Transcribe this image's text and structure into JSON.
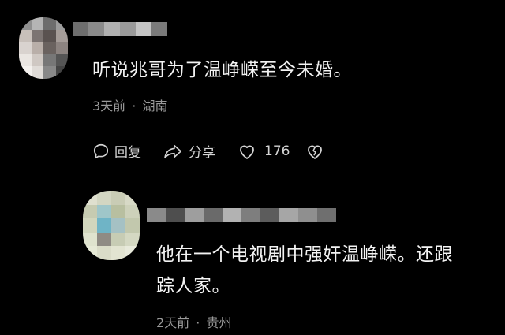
{
  "comments": [
    {
      "text": "听说兆哥为了温峥嵘至今未婚。",
      "time": "3天前",
      "location": "湖南",
      "actions": {
        "reply": "回复",
        "share": "分享",
        "likes": "176"
      }
    },
    {
      "text_line1": "他在一个电视剧中强奸温峥嵘。还跟",
      "text_line2": "踪人家。",
      "time": "2天前",
      "location": "贵州"
    }
  ],
  "separator": "·",
  "icons": {
    "reply": "speech-bubble-icon",
    "share": "share-arrow-icon",
    "like": "heart-icon",
    "dislike": "broken-heart-icon"
  },
  "colors": {
    "background": "#000000",
    "text": "#f3f3f3",
    "meta": "#9a9a9a"
  }
}
